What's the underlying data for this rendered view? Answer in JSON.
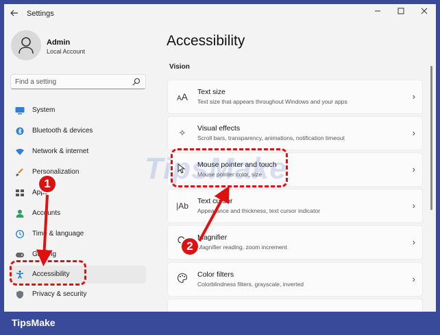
{
  "window": {
    "title": "Settings"
  },
  "profile": {
    "name": "Admin",
    "account_type": "Local Account"
  },
  "search": {
    "placeholder": "Find a setting"
  },
  "sidebar": {
    "items": [
      {
        "label": "System",
        "icon": "monitor-icon"
      },
      {
        "label": "Bluetooth & devices",
        "icon": "bluetooth-icon"
      },
      {
        "label": "Network & internet",
        "icon": "wifi-icon"
      },
      {
        "label": "Personalization",
        "icon": "brush-icon"
      },
      {
        "label": "Apps",
        "icon": "apps-icon"
      },
      {
        "label": "Accounts",
        "icon": "person-icon"
      },
      {
        "label": "Time & language",
        "icon": "clock-icon"
      },
      {
        "label": "Gaming",
        "icon": "gamepad-icon"
      },
      {
        "label": "Accessibility",
        "icon": "accessibility-icon",
        "active": true
      },
      {
        "label": "Privacy & security",
        "icon": "shield-icon"
      }
    ]
  },
  "main": {
    "title": "Accessibility",
    "section": "Vision",
    "cards": [
      {
        "title": "Text size",
        "subtitle": "Text size that appears throughout Windows and your apps",
        "icon": "text-size-icon"
      },
      {
        "title": "Visual effects",
        "subtitle": "Scroll bars, transparency, animations, notification timeout",
        "icon": "sparkle-icon"
      },
      {
        "title": "Mouse pointer and touch",
        "subtitle": "Mouse pointer color, size",
        "icon": "mouse-pointer-icon"
      },
      {
        "title": "Text cursor",
        "subtitle": "Appearance and thickness, text cursor indicator",
        "icon": "text-cursor-icon"
      },
      {
        "title": "Magnifier",
        "subtitle": "Magnifier reading, zoom increment",
        "icon": "magnifier-icon"
      },
      {
        "title": "Color filters",
        "subtitle": "Colorblindness filters, grayscale, inverted",
        "icon": "palette-icon"
      }
    ]
  },
  "annotations": {
    "step1": "1",
    "step2": "2"
  },
  "watermark": "TipsMake",
  "footer": {
    "brand": "TipsMake"
  },
  "colors": {
    "annotation": "#dd1111",
    "frame": "#3a4a9a",
    "accessibility_blue": "#0067c0"
  }
}
